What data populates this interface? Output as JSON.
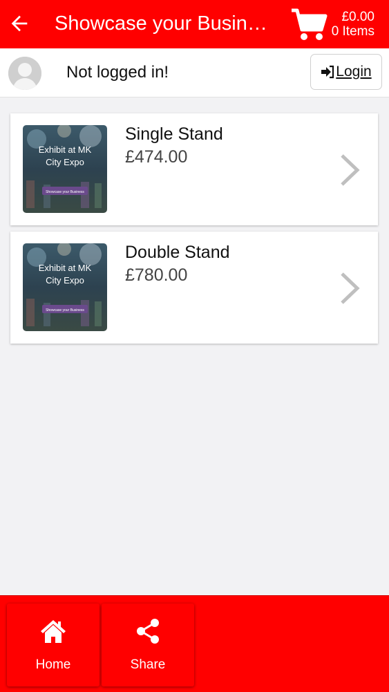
{
  "header": {
    "title": "Showcase your Busine...",
    "back_icon": "arrow-left-icon",
    "cart": {
      "icon": "cart-icon",
      "total": "£0.00",
      "items": "0 Items"
    }
  },
  "user": {
    "status": "Not logged in!",
    "avatar_icon": "avatar-icon",
    "login_label": " Login",
    "login_icon": "sign-in-icon"
  },
  "products": [
    {
      "name": "Single Stand",
      "price": "£474.00",
      "thumb": {
        "heading_line1": "Exhibit at MK",
        "heading_line2": "City Expo",
        "button": "Showcase your Business"
      }
    },
    {
      "name": "Double Stand",
      "price": "£780.00",
      "thumb": {
        "heading_line1": "Exhibit at MK",
        "heading_line2": "City Expo",
        "button": "Showcase your Business"
      }
    }
  ],
  "bottom_nav": [
    {
      "label": "Home",
      "icon": "home-icon"
    },
    {
      "label": "Share",
      "icon": "share-icon"
    }
  ],
  "colors": {
    "brand": "#ff0000",
    "background": "#f2f2f4",
    "thumb_button": "#6a4a8c"
  }
}
